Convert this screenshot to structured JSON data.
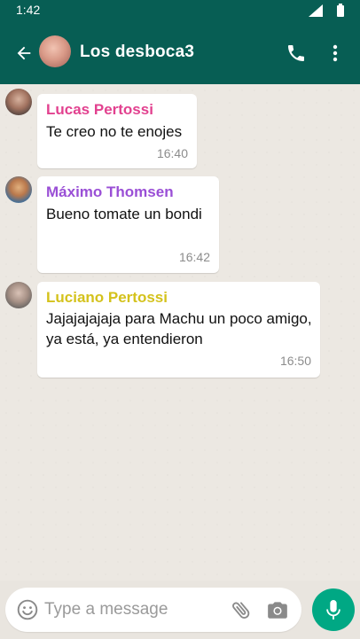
{
  "status_bar": {
    "time": "1:42"
  },
  "header": {
    "title": "Los desboca3"
  },
  "messages": [
    {
      "sender": "Lucas Pertossi",
      "sender_color": "#e2418f",
      "text": "Te creo no te enojes",
      "time": "16:40"
    },
    {
      "sender": "Máximo Thomsen",
      "sender_color": "#9a4fd6",
      "text": "Bueno tomate un bondi",
      "time": "16:42"
    },
    {
      "sender": "Luciano Pertossi",
      "sender_color": "#d4c21c",
      "text": "Jajajajajaja para Machu un poco amigo, ya está, ya entendieron",
      "time": "16:50"
    }
  ],
  "composer": {
    "placeholder": "Type a message"
  },
  "colors": {
    "header": "#075e54",
    "accent": "#00a884",
    "chat_background": "#ece8e2"
  },
  "icons": [
    "back-arrow-icon",
    "phone-icon",
    "more-vertical-icon",
    "emoji-icon",
    "attach-icon",
    "camera-icon",
    "mic-icon",
    "signal-icon",
    "battery-icon"
  ]
}
